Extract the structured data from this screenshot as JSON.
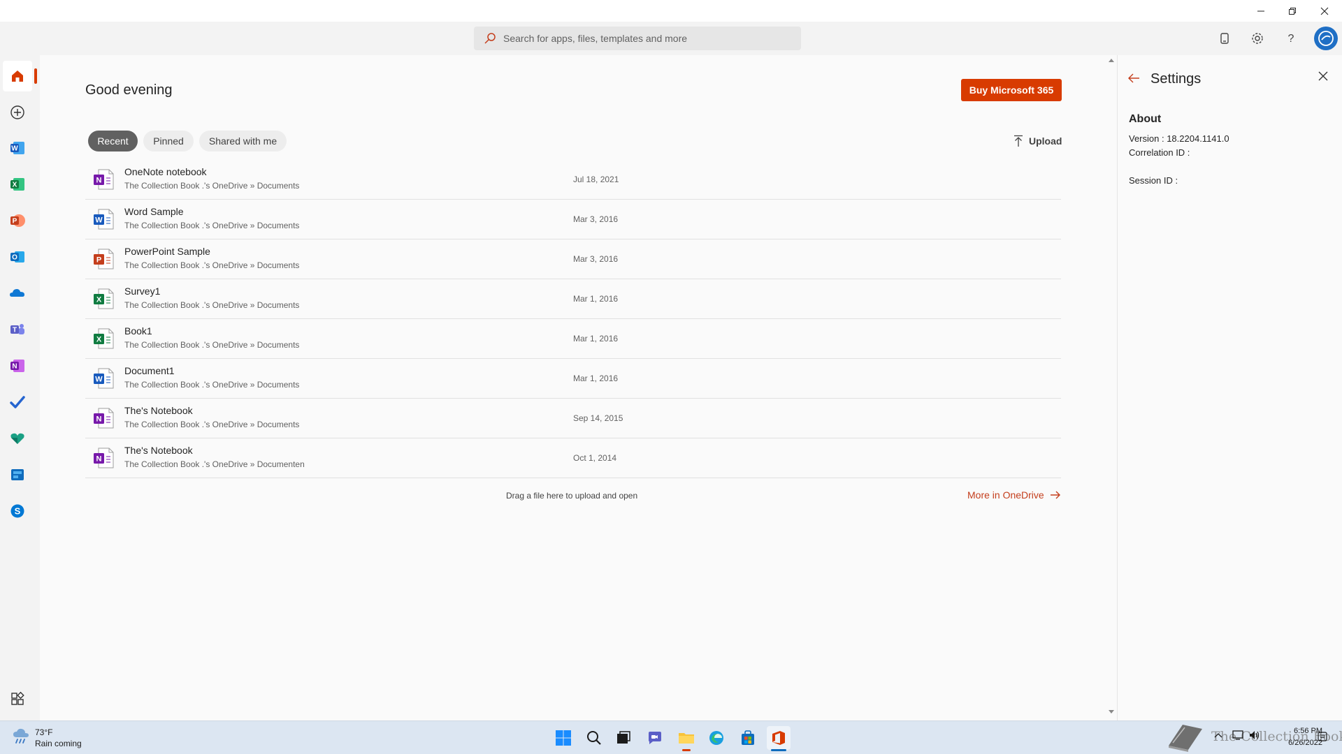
{
  "search": {
    "placeholder": "Search for apps, files, templates and more"
  },
  "main": {
    "greeting": "Good evening",
    "buy_button": "Buy Microsoft 365",
    "tabs": [
      {
        "label": "Recent",
        "active": true
      },
      {
        "label": "Pinned",
        "active": false
      },
      {
        "label": "Shared with me",
        "active": false
      }
    ],
    "upload_label": "Upload",
    "files": [
      {
        "name": "OneNote notebook",
        "path": "The Collection Book .'s OneDrive » Documents",
        "date": "Jul 18, 2021",
        "app": "onenote"
      },
      {
        "name": "Word Sample",
        "path": "The Collection Book .'s OneDrive » Documents",
        "date": "Mar 3, 2016",
        "app": "word"
      },
      {
        "name": "PowerPoint Sample",
        "path": "The Collection Book .'s OneDrive » Documents",
        "date": "Mar 3, 2016",
        "app": "powerpoint"
      },
      {
        "name": "Survey1",
        "path": "The Collection Book .'s OneDrive » Documents",
        "date": "Mar 1, 2016",
        "app": "excel"
      },
      {
        "name": "Book1",
        "path": "The Collection Book .'s OneDrive » Documents",
        "date": "Mar 1, 2016",
        "app": "excel"
      },
      {
        "name": "Document1",
        "path": "The Collection Book .'s OneDrive » Documents",
        "date": "Mar 1, 2016",
        "app": "word"
      },
      {
        "name": "The's Notebook",
        "path": "The Collection Book .'s OneDrive » Documents",
        "date": "Sep 14, 2015",
        "app": "onenote"
      },
      {
        "name": "The's Notebook",
        "path": "The Collection Book .'s OneDrive » Documenten",
        "date": "Oct 1, 2014",
        "app": "onenote"
      }
    ],
    "drag_hint": "Drag a file here to upload and open",
    "more_link": "More in OneDrive"
  },
  "settings": {
    "title": "Settings",
    "about_heading": "About",
    "version": "Version : 18.2204.1141.0",
    "correlation_id": "Correlation ID :",
    "session_id": "Session ID :"
  },
  "taskbar": {
    "weather_temp": "73°F",
    "weather_desc": "Rain coming",
    "time": "6:56 PM",
    "date": "6/26/2022",
    "watermark": "The Collection Book"
  },
  "colors": {
    "accent": "#d83b01",
    "word": "#185abd",
    "excel": "#107c41",
    "powerpoint": "#c43e1c",
    "onenote": "#7719aa",
    "outlook": "#0f6cbd",
    "onedrive": "#0f78d4",
    "teams": "#5b5fc7"
  }
}
